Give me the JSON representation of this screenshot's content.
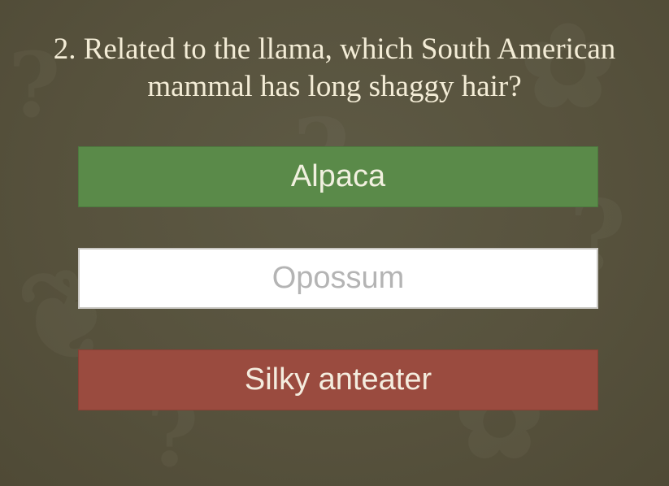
{
  "quiz": {
    "question": "2. Related to the llama, which South American mammal has long shaggy hair?",
    "answers": [
      {
        "label": "Alpaca",
        "state": "correct"
      },
      {
        "label": "Opossum",
        "state": "unselected"
      },
      {
        "label": "Silky anteater",
        "state": "incorrect"
      }
    ]
  },
  "colors": {
    "background": "#57523d",
    "correct": "#5a8a49",
    "incorrect": "#9a4b3f",
    "neutral": "#ffffff",
    "question_text": "#f3ecd6"
  }
}
